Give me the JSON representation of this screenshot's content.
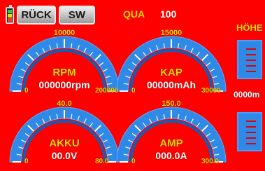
{
  "header": {
    "buttons": [
      {
        "label": "RÜCK"
      },
      {
        "label": "SW"
      }
    ],
    "qua_label": "QUA",
    "qua_value": "100"
  },
  "gauges": [
    {
      "title": "RPM",
      "value": "000000rpm",
      "min": "0",
      "max": "200000",
      "mid": "10000"
    },
    {
      "title": "KAP",
      "value": "00000mAh",
      "min": "0",
      "max": "30000",
      "mid": "15000"
    },
    {
      "title": "AKKU",
      "value": "00.0V",
      "min": "0",
      "max": "80.0",
      "mid": "40.0"
    },
    {
      "title": "AMP",
      "value": "000.0A",
      "min": "0",
      "max": "300.0",
      "mid": "150.0"
    }
  ],
  "altitude": {
    "label": "HÖHE",
    "value": "0000m"
  },
  "colors": {
    "background": "#ff0000",
    "gauge_fill": "#2f89e6",
    "gauge_dark": "#0f5fb6",
    "tick": "#ffffff",
    "accent_yellow": "#ffd700",
    "button_bg": "#e3e3e3"
  }
}
